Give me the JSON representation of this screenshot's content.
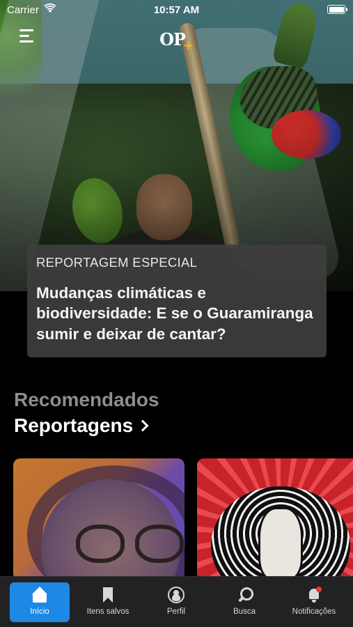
{
  "status_bar": {
    "carrier": "Carrier",
    "time": "10:57 AM"
  },
  "header": {
    "logo_text": "OP",
    "logo_plus": "+",
    "logo_accent_color": "#f0b12e"
  },
  "featured_story": {
    "kicker": "REPORTAGEM ESPECIAL",
    "title": "Mudanças climáticas e biodiversidade: E se o Guaramiranga sumir e deixar de cantar?"
  },
  "recommended": {
    "eyebrow": "Recomendados",
    "title": "Reportagens",
    "cards": [
      {
        "image": "woman-with-glasses-illustration"
      },
      {
        "image": "bearded-man-red-illustration"
      }
    ]
  },
  "tabbar": {
    "active_color": "#1e88e5",
    "items": [
      {
        "label": "Início",
        "icon": "home-icon",
        "active": true
      },
      {
        "label": "Itens salvos",
        "icon": "bookmark-icon",
        "active": false
      },
      {
        "label": "Perfil",
        "icon": "profile-icon",
        "active": false
      },
      {
        "label": "Busca",
        "icon": "search-icon",
        "active": false
      },
      {
        "label": "Notificações",
        "icon": "bell-icon",
        "active": false
      }
    ]
  }
}
